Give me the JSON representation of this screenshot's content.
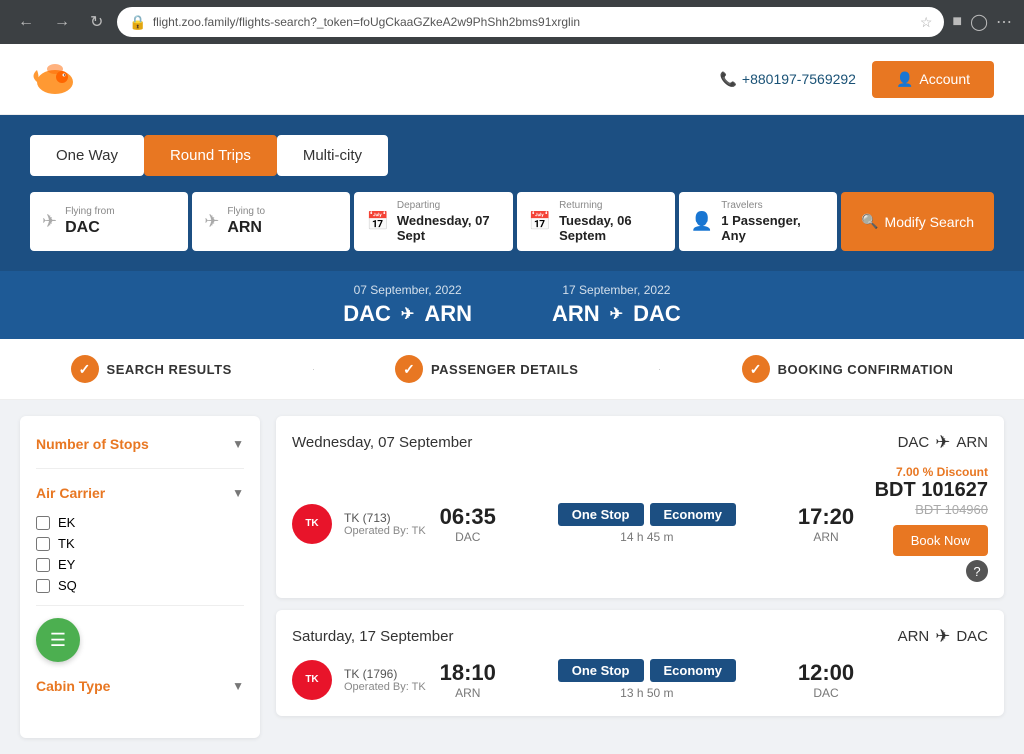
{
  "browser": {
    "url": "flight.zoo.family/flights-search?_token=foUgCkaaGZkeA2w9PhShh2bms91xrglin",
    "back_btn": "←",
    "forward_btn": "→",
    "reload_btn": "↻"
  },
  "topbar": {
    "phone": "+880197-7569292",
    "account_label": "Account"
  },
  "trip_tabs": [
    {
      "label": "One Way",
      "active": false
    },
    {
      "label": "Round Trips",
      "active": true
    },
    {
      "label": "Multi-city",
      "active": false
    }
  ],
  "search_form": {
    "flying_from_label": "Flying from",
    "flying_from_value": "DAC",
    "flying_to_label": "Flying to",
    "flying_to_value": "ARN",
    "departing_label": "Departing",
    "departing_value": "Wednesday, 07 Sept",
    "returning_label": "Returning",
    "returning_value": "Tuesday, 06 Septem",
    "travelers_label": "Travelers",
    "travelers_value": "1 Passenger, Any",
    "modify_btn": "Modify Search"
  },
  "routes": [
    {
      "date": "07 September, 2022",
      "from": "DAC",
      "to": "ARN"
    },
    {
      "date": "17 September, 2022",
      "from": "ARN",
      "to": "DAC"
    }
  ],
  "progress": [
    {
      "label": "SEARCH RESULTS",
      "icon": "✓"
    },
    {
      "label": "PASSENGER DETAILS",
      "icon": "✓"
    },
    {
      "label": "BOOKING CONFIRMATION",
      "icon": "✓"
    }
  ],
  "sidebar": {
    "stops_filter_label": "Number of Stops",
    "carrier_filter_label": "Air Carrier",
    "carriers": [
      "EK",
      "TK",
      "EY",
      "SQ"
    ],
    "cabin_type_label": "Cabin Type"
  },
  "flight_sections": [
    {
      "date_header": "Wednesday, 07 September",
      "from": "DAC",
      "to": "ARN",
      "flights": [
        {
          "airline_code": "TK",
          "airline_full": "TK (713)",
          "operated_by": "Operated By: TK",
          "depart_time": "06:35",
          "depart_airport": "DAC",
          "stop_label": "One Stop",
          "cabin_label": "Economy",
          "duration": "14 h 45 m",
          "arrive_time": "17:20",
          "arrive_airport": "ARN",
          "discount": "7.00 % Discount",
          "price": "BDT 101627",
          "original_price": "BDT 104960",
          "book_label": "Book Now"
        }
      ]
    },
    {
      "date_header": "Saturday, 17 September",
      "from": "ARN",
      "to": "DAC",
      "flights": [
        {
          "airline_code": "TK",
          "airline_full": "TK (1796)",
          "operated_by": "Operated By: TK",
          "depart_time": "18:10",
          "depart_airport": "ARN",
          "stop_label": "One Stop",
          "cabin_label": "Economy",
          "duration": "13 h 50 m",
          "arrive_time": "12:00",
          "arrive_airport": "DAC",
          "discount": "",
          "price": "",
          "original_price": "",
          "book_label": ""
        }
      ]
    }
  ]
}
